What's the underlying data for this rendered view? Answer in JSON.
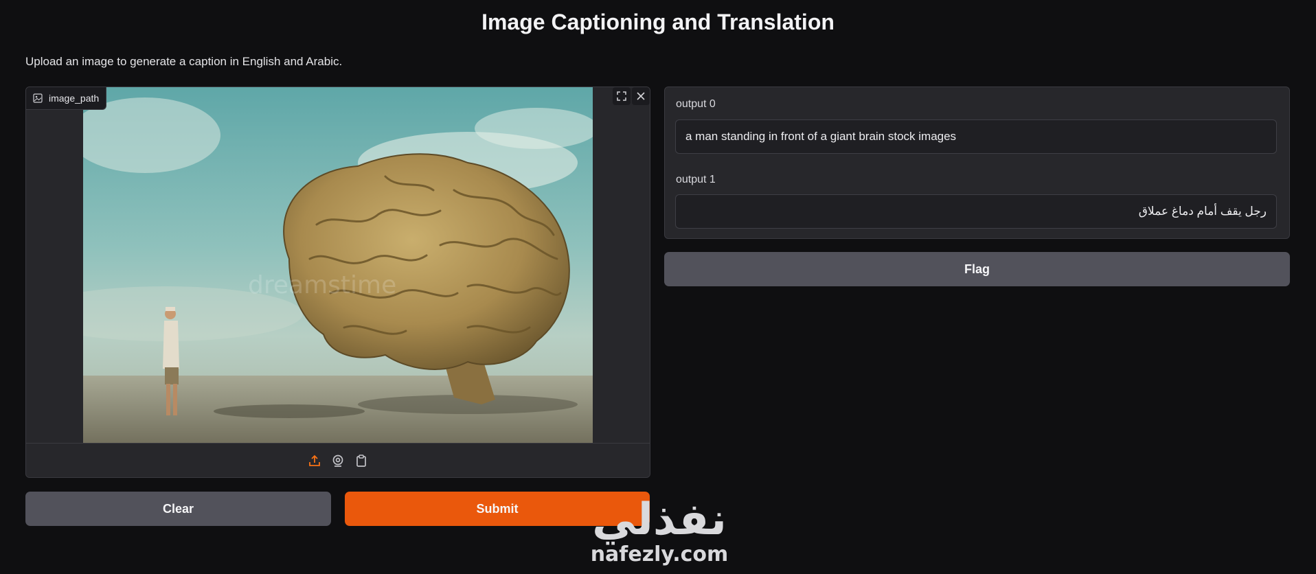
{
  "header": {
    "title": "Image Captioning and Translation",
    "description": "Upload an image to generate a caption in English and Arabic."
  },
  "image_input": {
    "label": "image_path",
    "label_icon": "image-icon",
    "tools": [
      "fullscreen-icon",
      "close-icon"
    ],
    "sources": [
      "upload-icon",
      "webcam-icon",
      "clipboard-icon"
    ],
    "image_content": "man standing in front of a giant brain"
  },
  "actions": {
    "clear_label": "Clear",
    "submit_label": "Submit",
    "flag_label": "Flag"
  },
  "outputs": [
    {
      "label": "output 0",
      "value": "a man standing in front of a giant brain stock images"
    },
    {
      "label": "output 1",
      "value": "رجل يقف أمام دماغ عملاق"
    }
  ],
  "watermark": {
    "arabic": "نفذلي",
    "latin": "nafezly.com"
  },
  "colors": {
    "background": "#0f0f11",
    "panel": "#27272b",
    "secondary_button": "#52525b",
    "primary_button": "#ea580c",
    "accent_icon": "#f97316"
  }
}
